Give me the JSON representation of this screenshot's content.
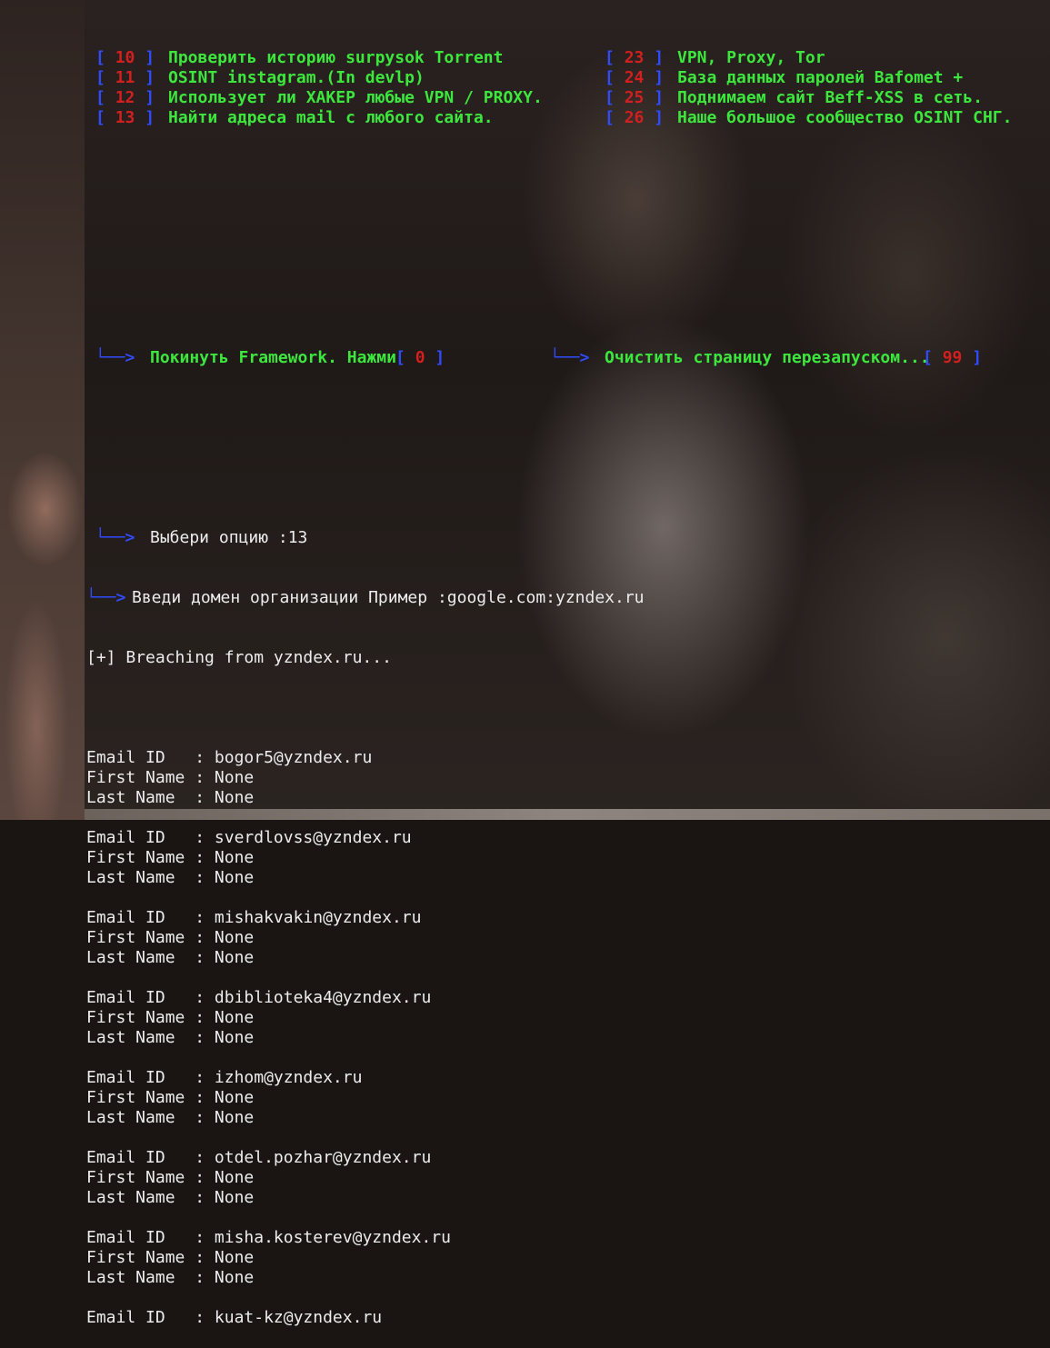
{
  "menu": {
    "rows": [
      {
        "left_num": "10",
        "left_text": "Проверить историю surpysok Torrent",
        "right_num": "23",
        "right_text": "VPN, Proxy, Tor"
      },
      {
        "left_num": "11",
        "left_text": "OSINT instagram.(In devlp)",
        "right_num": "24",
        "right_text": "База данных паролей Bafomet +"
      },
      {
        "left_num": "12",
        "left_text": "Использует ли ХАКЕР любые VPN / PROXY.",
        "right_num": "25",
        "right_text": "Поднимаем сайт Beff-XSS в сеть."
      },
      {
        "left_num": "13",
        "left_text": "Найти адреса mail с любого сайта.",
        "right_num": "26",
        "right_text": "Наше большое сообщество OSINT СНГ."
      }
    ],
    "exit_text": "Покинуть Framework. Нажми",
    "exit_num": "0",
    "clear_text": "Очистить страницу перезапуском...",
    "clear_num": "99"
  },
  "prompt": {
    "arrow1": "└──>",
    "arrow2": "└──>",
    "choose": "Выбери опцию :13",
    "domain_arrow": "└──>",
    "domain_prompt": "Введи домен организации Пример :google.com:yzndex.ru",
    "breaching": "[+] Breaching from yzndex.ru..."
  },
  "labels": {
    "email": "Email ID   : ",
    "first": "First Name : ",
    "last": "Last Name  : "
  },
  "results": [
    {
      "email": "bogor5@yzndex.ru",
      "first": "None",
      "last": "None"
    },
    {
      "email": "sverdlovss@yzndex.ru",
      "first": "None",
      "last": "None"
    },
    {
      "email": "mishakvakin@yzndex.ru",
      "first": "None",
      "last": "None"
    },
    {
      "email": "dbiblioteka4@yzndex.ru",
      "first": "None",
      "last": "None"
    },
    {
      "email": "izhom@yzndex.ru",
      "first": "None",
      "last": "None"
    },
    {
      "email": "otdel.pozhar@yzndex.ru",
      "first": "None",
      "last": "None"
    },
    {
      "email": "misha.kosterev@yzndex.ru",
      "first": "None",
      "last": "None"
    },
    {
      "email": "kuat-kz@yzndex.ru",
      "first": null,
      "last": null
    }
  ],
  "colors": {
    "green": "#3ce63c",
    "blue": "#2f4bff",
    "red": "#d21f1f",
    "white": "#ececec"
  }
}
